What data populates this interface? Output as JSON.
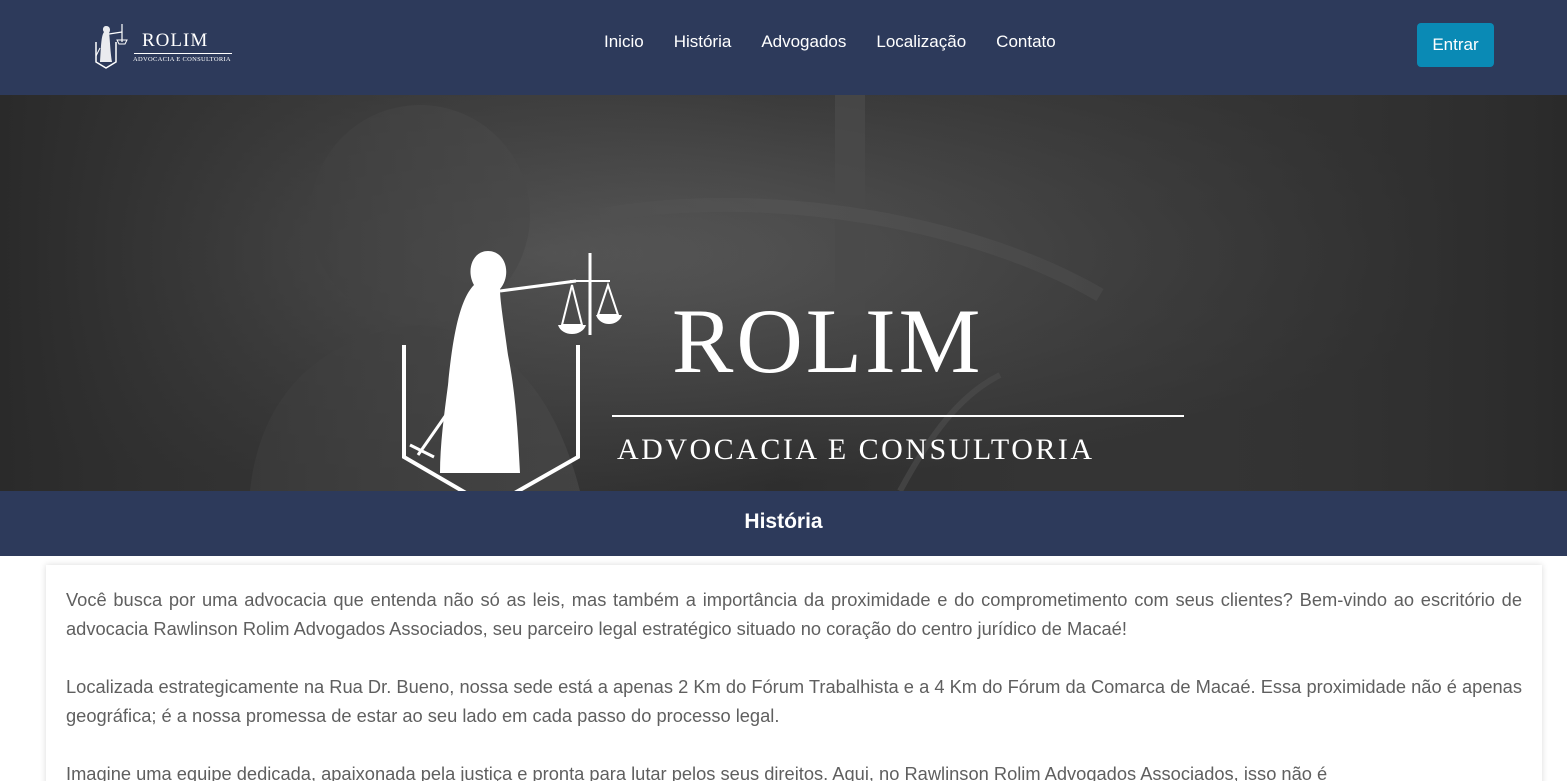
{
  "brand": {
    "name": "ROLIM",
    "tagline": "ADVOCACIA E CONSULTORIA"
  },
  "nav": {
    "items": [
      {
        "label": "Inicio"
      },
      {
        "label": "História"
      },
      {
        "label": "Advogados"
      },
      {
        "label": "Localização"
      },
      {
        "label": "Contato"
      }
    ],
    "login_label": "Entrar"
  },
  "hero": {
    "title": "ROLIM",
    "subtitle": "ADVOCACIA E CONSULTORIA"
  },
  "section": {
    "title": "História"
  },
  "content": {
    "paragraphs": [
      "Você busca por uma advocacia que entenda não só as leis, mas também a importância da proximidade e do comprometimento com seus clientes? Bem-vindo ao escritório de advocacia Rawlinson Rolim Advogados Associados, seu parceiro legal estratégico situado no coração do centro jurídico de Macaé!",
      "Localizada estrategicamente na Rua Dr. Bueno, nossa sede está a apenas 2 Km do Fórum Trabalhista e a 4 Km do Fórum da Comarca de Macaé. Essa proximidade não é apenas geográfica; é a nossa promessa de estar ao seu lado em cada passo do processo legal.",
      "Imagine uma equipe dedicada, apaixonada pela justiça e pronta para lutar pelos seus direitos. Aqui, no Rawlinson Rolim Advogados Associados, isso não é"
    ]
  },
  "colors": {
    "navbar": "#2d3a5b",
    "button": "#0a8ab5",
    "hero_bg": "#3c3c3c"
  }
}
